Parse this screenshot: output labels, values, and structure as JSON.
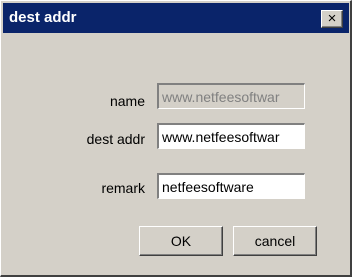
{
  "window": {
    "title": "dest addr",
    "close_icon": "close-icon",
    "close_glyph": "×"
  },
  "form": {
    "name": {
      "label": "name",
      "value": "www.netfeesoftwar"
    },
    "dest_addr": {
      "label": "dest addr",
      "value": "www.netfeesoftwar"
    },
    "remark": {
      "label": "remark",
      "value": "netfeesoftware"
    }
  },
  "buttons": {
    "ok_label": "OK",
    "cancel_label": "cancel"
  },
  "colors": {
    "title_bar": "#0a246a",
    "dialog_face": "#d4d0c8"
  }
}
